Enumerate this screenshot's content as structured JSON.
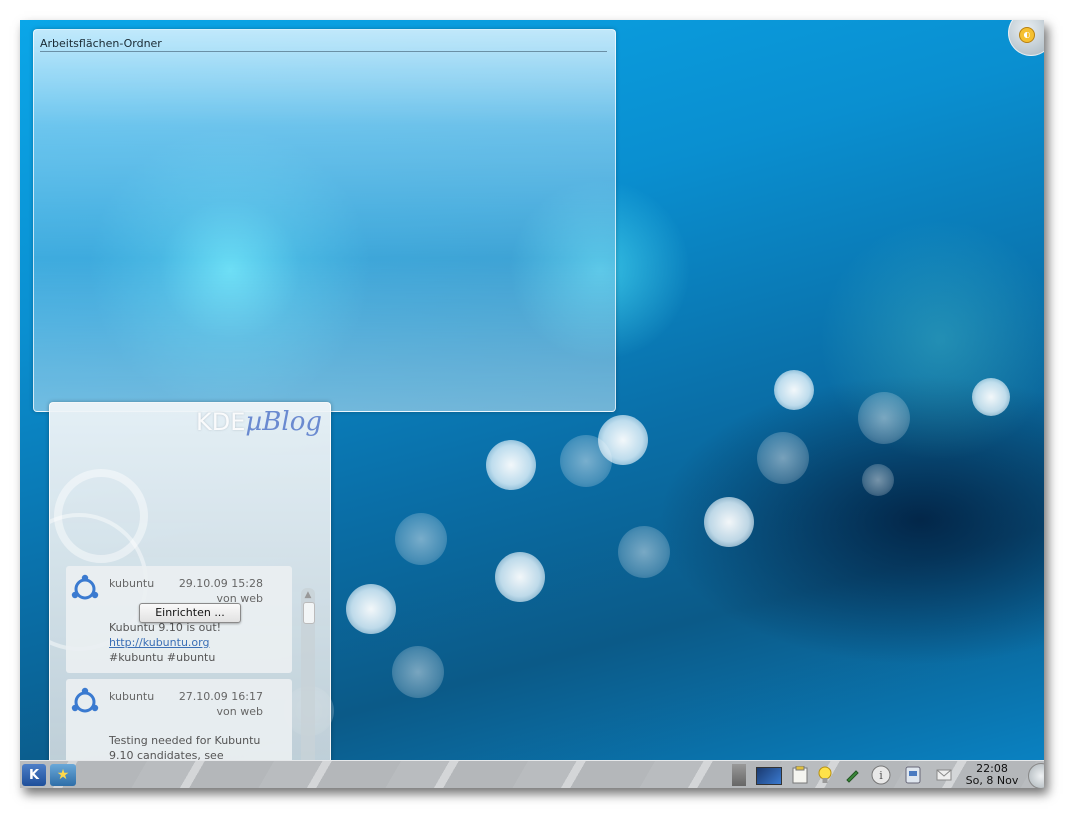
{
  "folder_view": {
    "title": "Arbeitsflächen-Ordner"
  },
  "ublog": {
    "logo_prefix": "KDE",
    "logo_main": "µBlog",
    "configure_button": "Einrichten ...",
    "posts": [
      {
        "user": "kubuntu",
        "time": "29.10.09 15:28",
        "source": "von web",
        "line1": "Kubuntu 9.10 is out!",
        "link": "http://kubuntu.org",
        "line3": "#kubuntu #ubuntu"
      },
      {
        "user": "kubuntu",
        "time": "27.10.09 16:17",
        "source": "von web",
        "line1": "Testing needed for Kubuntu",
        "line2": "9.10 candidates, see"
      }
    ]
  },
  "panel": {
    "clock_time": "22:08",
    "clock_date": "So, 8 Nov"
  },
  "icons": [
    "kde-menu-icon",
    "favorites-star-icon",
    "pager-icon",
    "desktop-icon",
    "clipboard-icon",
    "lightbulb-icon",
    "pin-icon",
    "info-icon",
    "network-icon",
    "mail-icon",
    "cashew-icon"
  ],
  "colors": {
    "accent": "#0a8fd0",
    "link": "#3b6fb6"
  }
}
